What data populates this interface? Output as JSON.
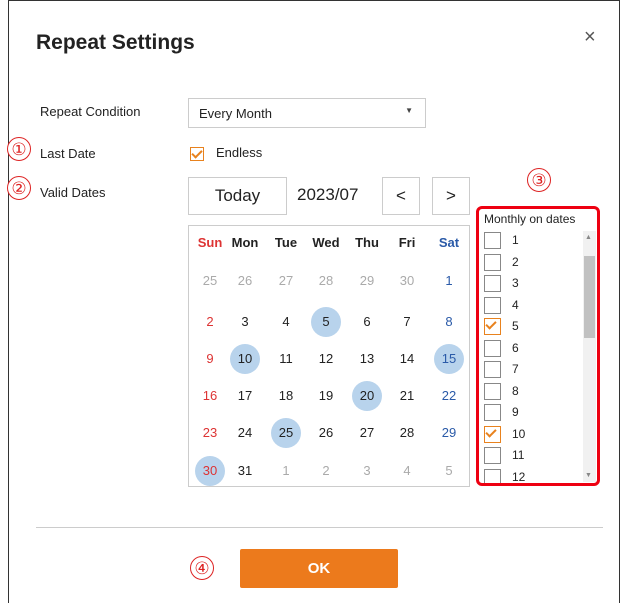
{
  "dialog": {
    "title": "Repeat Settings",
    "close_glyph": "×",
    "close_icon": "close-icon"
  },
  "annotations": [
    "①",
    "②",
    "③",
    "④"
  ],
  "repeat_condition": {
    "label": "Repeat Condition",
    "value": "Every Month",
    "arrow": "▼"
  },
  "last_date": {
    "label": "Last Date",
    "endless_label": "Endless",
    "endless_checked": true
  },
  "valid_dates": {
    "label": "Valid Dates",
    "today_label": "Today",
    "month": "2023/07",
    "prev_label": "<",
    "next_label": ">"
  },
  "calendar": {
    "headers": [
      "Sun",
      "Mon",
      "Tue",
      "Wed",
      "Thu",
      "Fri",
      "Sat"
    ],
    "weeks": [
      [
        "25",
        "26",
        "27",
        "28",
        "29",
        "30",
        "1"
      ],
      [
        "2",
        "3",
        "4",
        "5",
        "6",
        "7",
        "8"
      ],
      [
        "9",
        "10",
        "11",
        "12",
        "13",
        "14",
        "15"
      ],
      [
        "16",
        "17",
        "18",
        "19",
        "20",
        "21",
        "22"
      ],
      [
        "23",
        "24",
        "25",
        "26",
        "27",
        "28",
        "29"
      ],
      [
        "30",
        "31",
        "1",
        "2",
        "3",
        "4",
        "5"
      ]
    ],
    "selected": [
      "5",
      "10",
      "15",
      "20",
      "25",
      "30"
    ]
  },
  "monthly_dates": {
    "heading": "Monthly on dates",
    "items": [
      {
        "label": "1",
        "checked": false
      },
      {
        "label": "2",
        "checked": false
      },
      {
        "label": "3",
        "checked": false
      },
      {
        "label": "4",
        "checked": false
      },
      {
        "label": "5",
        "checked": true
      },
      {
        "label": "6",
        "checked": false
      },
      {
        "label": "7",
        "checked": false
      },
      {
        "label": "8",
        "checked": false
      },
      {
        "label": "9",
        "checked": false
      },
      {
        "label": "10",
        "checked": true
      },
      {
        "label": "11",
        "checked": false
      },
      {
        "label": "12",
        "checked": false
      }
    ],
    "scroll_up": "▲",
    "scroll_down": "▼"
  },
  "ok_label": "OK",
  "colors": {
    "accent": "#ec7a1c",
    "highlight": "#b8d3ec",
    "annotation": "#dd2222",
    "sunday": "#dd3333",
    "saturday": "#2a5aa8"
  }
}
